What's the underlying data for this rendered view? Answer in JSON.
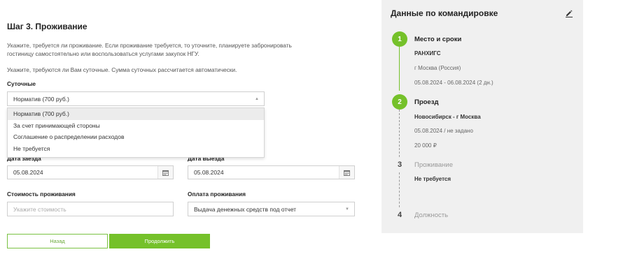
{
  "form": {
    "step_title": "Шаг 3. Проживание",
    "desc_line1": "Укажите, требуется ли проживание. Если проживание требуется, то уточните, планируете забронировать",
    "desc_line2": "гостиницу самостоятельно или воспользоваться услугами закупок НГУ.",
    "desc_line3": "Укажите, требуются ли Вам суточные. Сумма суточных рассчитается автоматически.",
    "daily_label": "Суточные",
    "daily_value": "Норматив (700 руб.)",
    "daily_options": [
      "Норматив (700 руб.)",
      "За счет принимающей стороны",
      "Соглашение о распределении расходов",
      "Не требуется"
    ],
    "checkin_label": "Дата заезда",
    "checkin_value": "05.08.2024",
    "checkout_label": "Дата выезда",
    "checkout_value": "05.08.2024",
    "cost_label": "Стоимость проживания",
    "cost_placeholder": "Укажите стоимость",
    "payment_label": "Оплата проживания",
    "payment_value": "Выдача денежных средств под отчет",
    "back_label": "Назад",
    "continue_label": "Продолжить"
  },
  "panel": {
    "title": "Данные по командировке",
    "steps": [
      {
        "num": "1",
        "title": "Место и сроки",
        "lines": [
          "РАНХИГС",
          "г Москва (Россия)",
          "05.08.2024 - 06.08.2024 (2 дн.)"
        ]
      },
      {
        "num": "2",
        "title": "Проезд",
        "lines": [
          "Новосибирск - г Москва",
          "05.08.2024 / не задано",
          "20 000 ₽"
        ]
      },
      {
        "num": "3",
        "title": "Проживание",
        "lines": [
          "Не требуется"
        ]
      },
      {
        "num": "4",
        "title": "Должность",
        "lines": []
      }
    ]
  },
  "colors": {
    "accent": "#75c12a",
    "panel_bg": "#f0f0f0"
  }
}
